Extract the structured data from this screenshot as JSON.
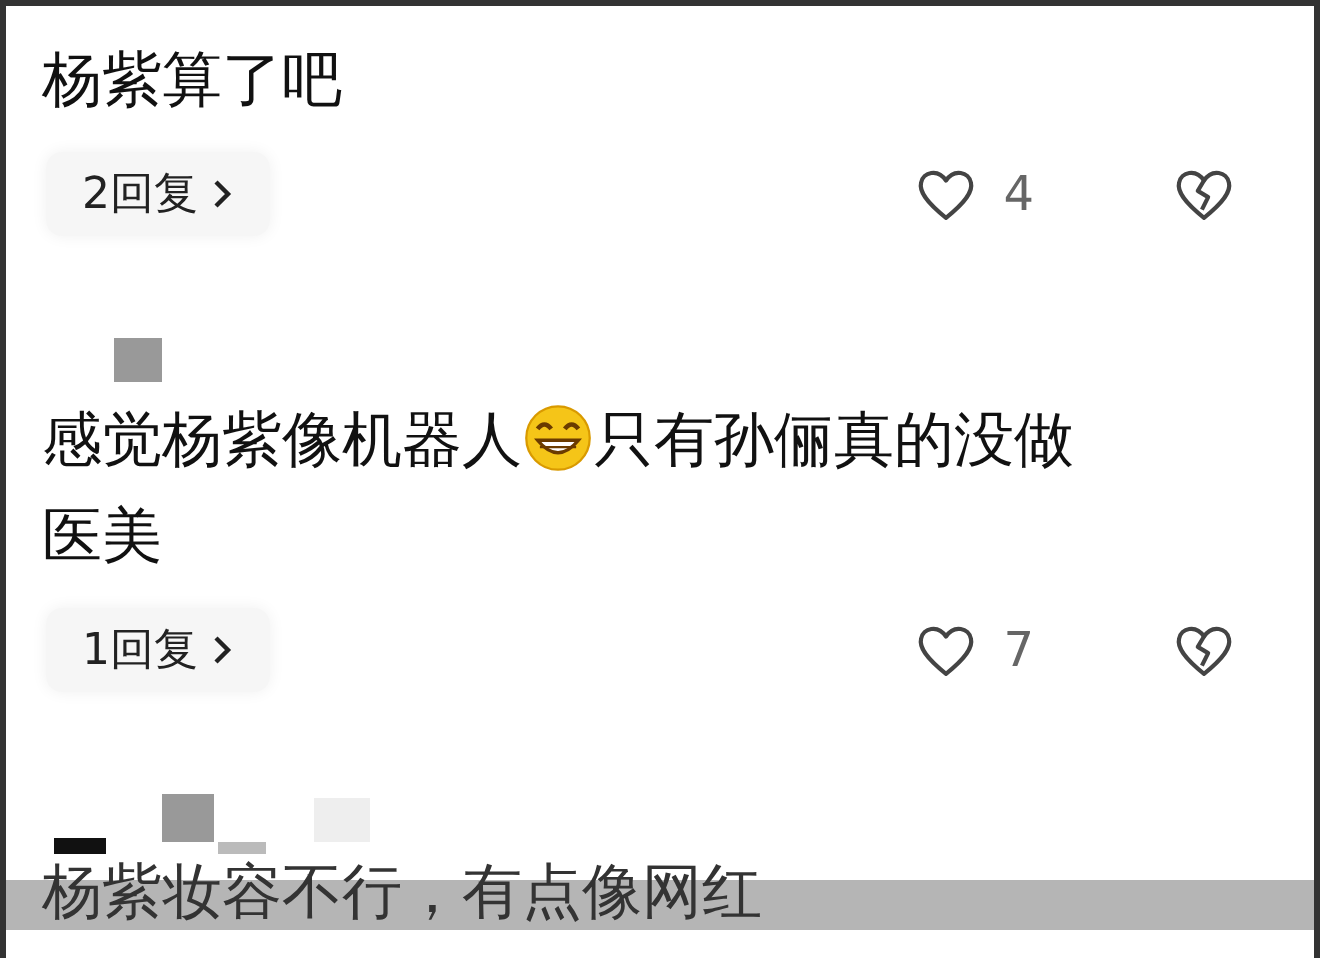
{
  "comments": [
    {
      "text": [
        "杨紫算了吧"
      ],
      "replies": "2回复",
      "likes": "4"
    },
    {
      "text": [
        "感觉杨紫像机器人",
        "只有孙俪真的没做医美"
      ],
      "replies": "1回复",
      "likes": "7"
    },
    {
      "text": [
        "杨紫妆容不行，有点像网红"
      ]
    }
  ]
}
